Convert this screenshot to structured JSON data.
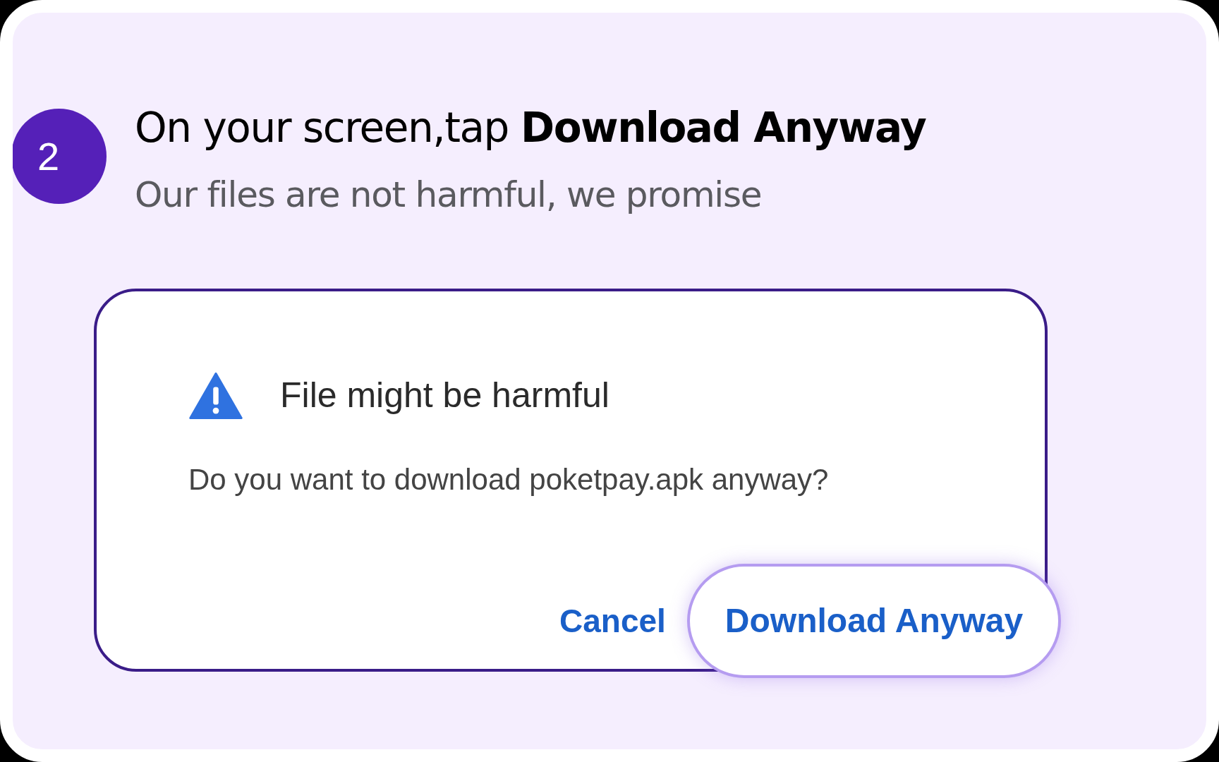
{
  "step": {
    "number": "2",
    "heading": "On your screen,tap **Download Anyway**",
    "subtitle": "Our files are not harmful, we promise"
  },
  "dialog": {
    "title": "File might be harmful",
    "message": "Do you want to download poketpay.apk anyway?",
    "buttons": [
      {
        "label": "Cancel",
        "highlighted": false
      },
      {
        "label": "Download Anyway",
        "highlighted": true
      }
    ]
  }
}
